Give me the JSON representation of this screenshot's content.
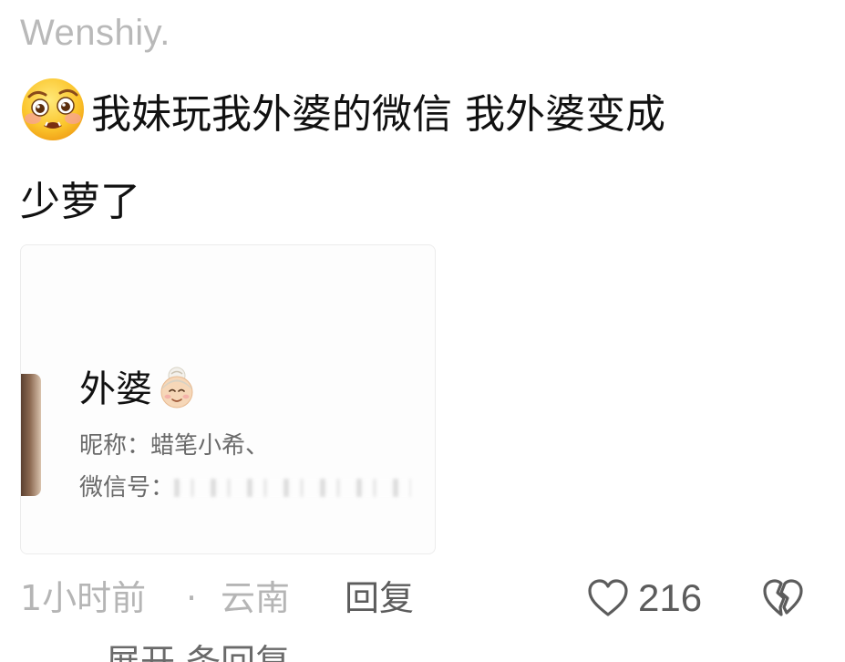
{
  "comment": {
    "username": "Wenshiy.",
    "emoji_icon": "pleading-face-emoji-icon",
    "text_line1": "我妹玩我外婆的微信 我外婆变成",
    "text_line2": "少萝了"
  },
  "card": {
    "name": "外婆",
    "name_emoji_icon": "older-woman-emoji-icon",
    "nickname": "昵称：蜡笔小希、",
    "wechat_id_label": "微信号："
  },
  "meta": {
    "time": "1小时前",
    "separator": "·",
    "location": "云南",
    "reply_label": "回复",
    "like_count": "216",
    "like_icon": "heart-outline-icon",
    "dislike_icon": "broken-heart-icon",
    "text_color": "#b5b5b5",
    "action_color": "#5c5c5c"
  },
  "next_reply_cut": "展开 条回复"
}
